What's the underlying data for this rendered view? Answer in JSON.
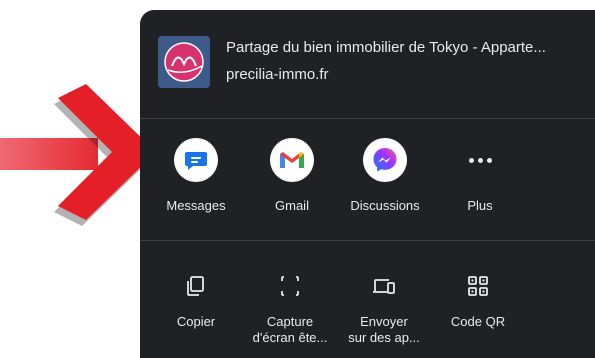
{
  "share_sheet": {
    "title": "Partage du bien immobilier de Tokyo - Apparte...",
    "url": "precilia-immo.fr"
  },
  "apps": [
    {
      "label": "Messages",
      "icon": "google-messages-icon"
    },
    {
      "label": "Gmail",
      "icon": "gmail-icon"
    },
    {
      "label": "Discussions",
      "icon": "messenger-icon"
    },
    {
      "label": "Plus",
      "icon": "more-dots-icon"
    }
  ],
  "actions": [
    {
      "label_1": "Copier",
      "label_2": "",
      "icon": "copy-icon"
    },
    {
      "label_1": "Capture",
      "label_2": "d'écran ête...",
      "icon": "screenshot-icon"
    },
    {
      "label_1": "Envoyer",
      "label_2": "sur des ap...",
      "icon": "devices-icon"
    },
    {
      "label_1": "Code QR",
      "label_2": "",
      "icon": "qr-code-icon"
    }
  ],
  "colors": {
    "sheet_bg": "#202124",
    "text": "#e8eaed",
    "arrow": "#e8383d"
  }
}
